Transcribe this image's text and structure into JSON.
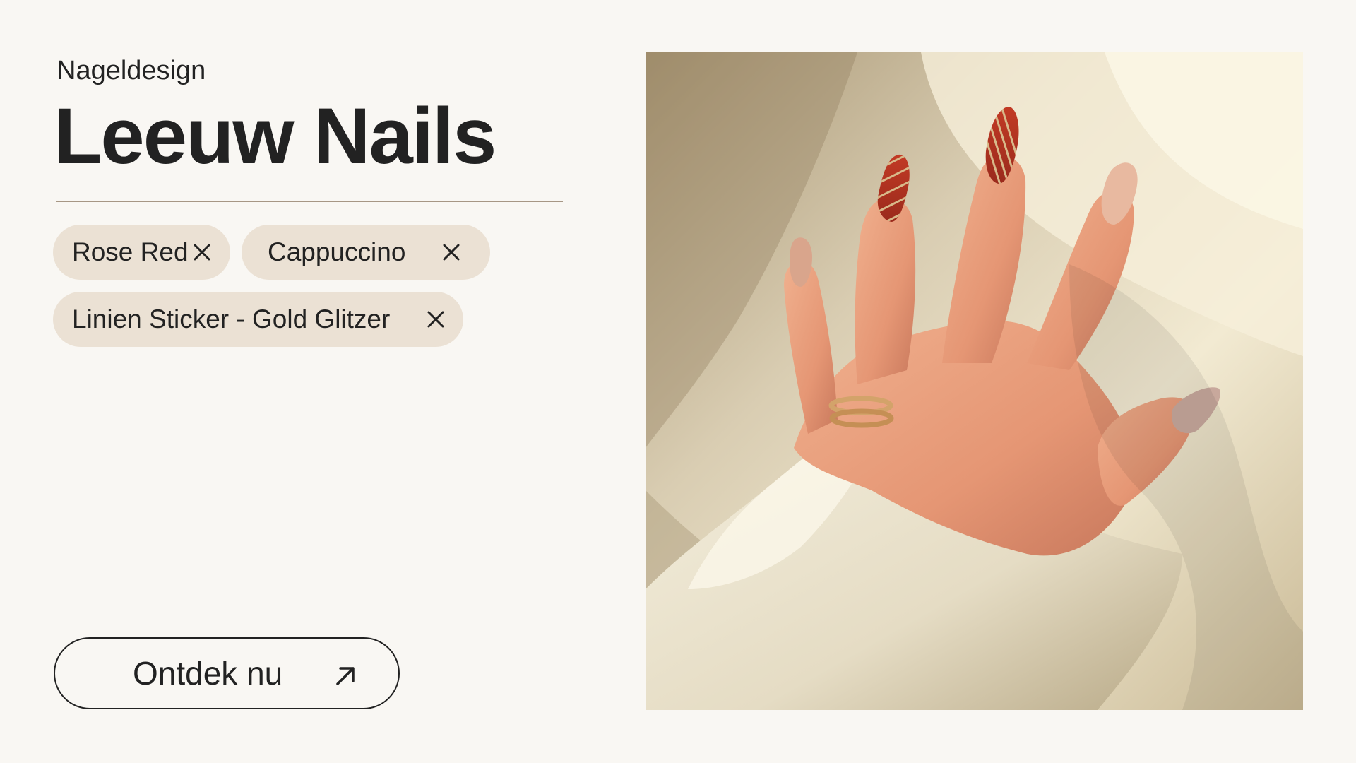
{
  "header": {
    "eyebrow": "Nageldesign",
    "title": "Leeuw Nails"
  },
  "chips": [
    {
      "label": "Rose Red",
      "remove_icon": "close-icon"
    },
    {
      "label": "Cappuccino",
      "remove_icon": "close-icon"
    },
    {
      "label": "Linien Sticker - Gold Glitzer",
      "remove_icon": "close-icon"
    }
  ],
  "cta": {
    "label": "Ontdek nu",
    "icon": "arrow-up-right-icon"
  },
  "colors": {
    "background": "#f9f7f3",
    "text": "#222222",
    "chip_background": "#ebe1d4",
    "divider": "#a79785"
  }
}
